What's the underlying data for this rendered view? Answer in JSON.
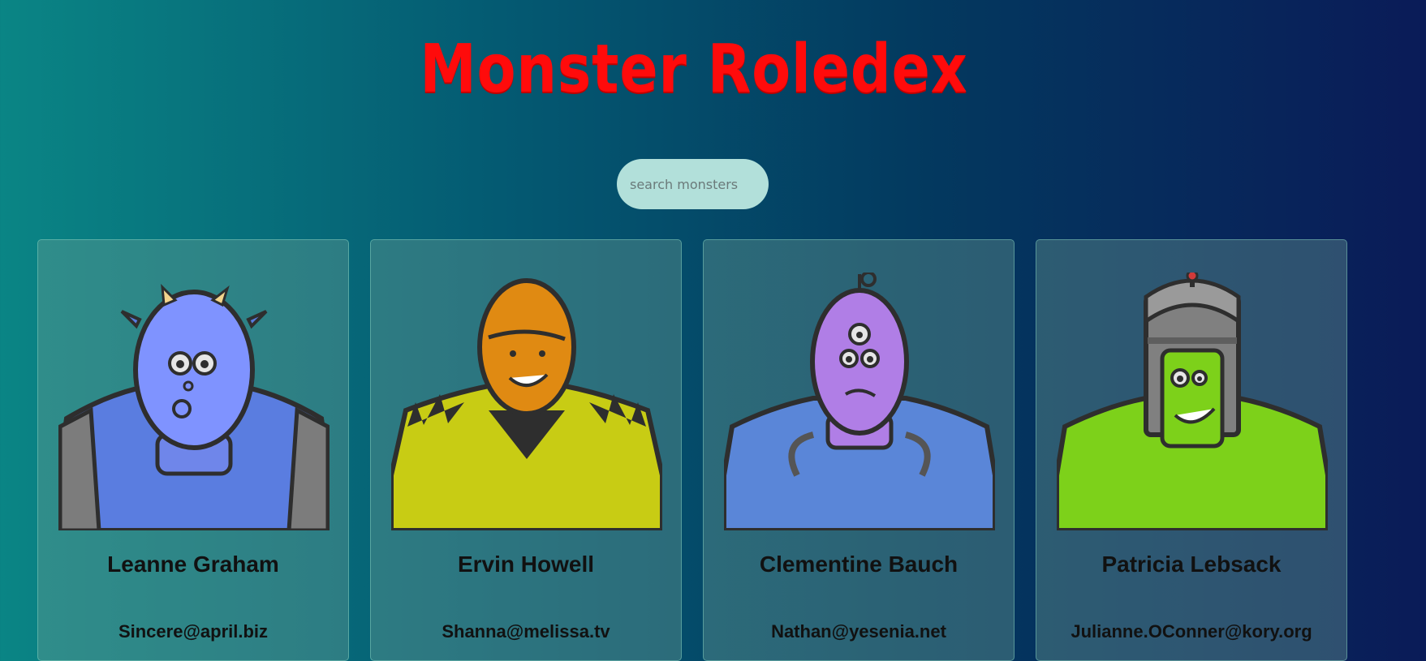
{
  "app": {
    "title": "Monster Roledex"
  },
  "search": {
    "placeholder": "search monsters",
    "value": ""
  },
  "monsters": [
    {
      "name": "Leanne Graham",
      "email": "Sincere@april.biz",
      "color": "#7f93ff"
    },
    {
      "name": "Ervin Howell",
      "email": "Shanna@melissa.tv",
      "color": "#e08a12"
    },
    {
      "name": "Clementine Bauch",
      "email": "Nathan@yesenia.net",
      "color": "#b07ee6"
    },
    {
      "name": "Patricia Lebsack",
      "email": "Julianne.OConner@kory.org",
      "color": "#7dd11a"
    }
  ]
}
